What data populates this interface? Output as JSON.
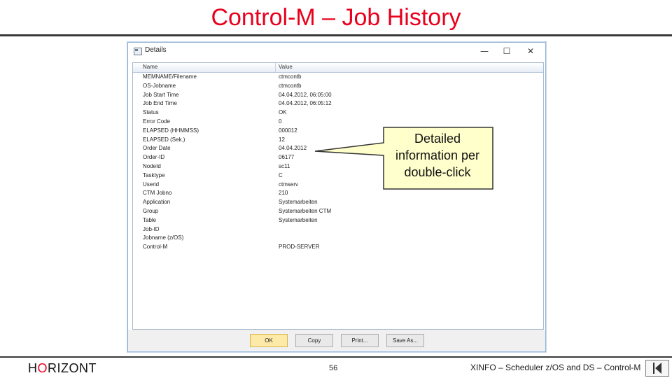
{
  "slide": {
    "title": "Control-M – Job History",
    "brand_pre": "H",
    "brand_o": "O",
    "brand_post": "RIZONT",
    "page_number": "56",
    "footer_text": "XINFO – Scheduler z/OS and DS – Control-M"
  },
  "dialog": {
    "title": "Details",
    "minimize": "—",
    "maximize": "☐",
    "close": "✕",
    "columns": [
      "Name",
      "Value"
    ],
    "rows": [
      {
        "name": "MEMNAME/Filename",
        "value": "ctmcontb"
      },
      {
        "name": "OS-Jobname",
        "value": "ctmcontb"
      },
      {
        "name": "Job Start Time",
        "value": "04.04.2012, 06:05:00"
      },
      {
        "name": "Job End Time",
        "value": "04.04.2012, 06:05:12"
      },
      {
        "name": "Status",
        "value": "OK"
      },
      {
        "name": "Error Code",
        "value": "0"
      },
      {
        "name": "ELAPSED (HHMMSS)",
        "value": "000012"
      },
      {
        "name": "ELAPSED (Sek.)",
        "value": "12"
      },
      {
        "name": "Order Date",
        "value": "04.04.2012"
      },
      {
        "name": "Order-ID",
        "value": "06177"
      },
      {
        "name": "NodeId",
        "value": "sc11"
      },
      {
        "name": "Tasktype",
        "value": "C"
      },
      {
        "name": "Userid",
        "value": "ctmserv"
      },
      {
        "name": "CTM Jobno",
        "value": "210"
      },
      {
        "name": "Application",
        "value": "Systemarbeiten"
      },
      {
        "name": "Group",
        "value": "Systemarbeiten CTM"
      },
      {
        "name": "Table",
        "value": "Systemarbeiten"
      },
      {
        "name": "Job-ID",
        "value": ""
      },
      {
        "name": "Jobname (z/OS)",
        "value": ""
      },
      {
        "name": "Control-M",
        "value": "PROD-SERVER"
      }
    ],
    "buttons": {
      "ok": "OK",
      "copy": "Copy",
      "print": "Print...",
      "save_as": "Save As..."
    }
  },
  "callout": {
    "line1": "Detailed",
    "line2": "information per",
    "line3": "double-click",
    "fill": "#ffffcc",
    "stroke": "#333333"
  },
  "colors": {
    "title": "#e8001c",
    "rule": "#3a3a3a"
  }
}
